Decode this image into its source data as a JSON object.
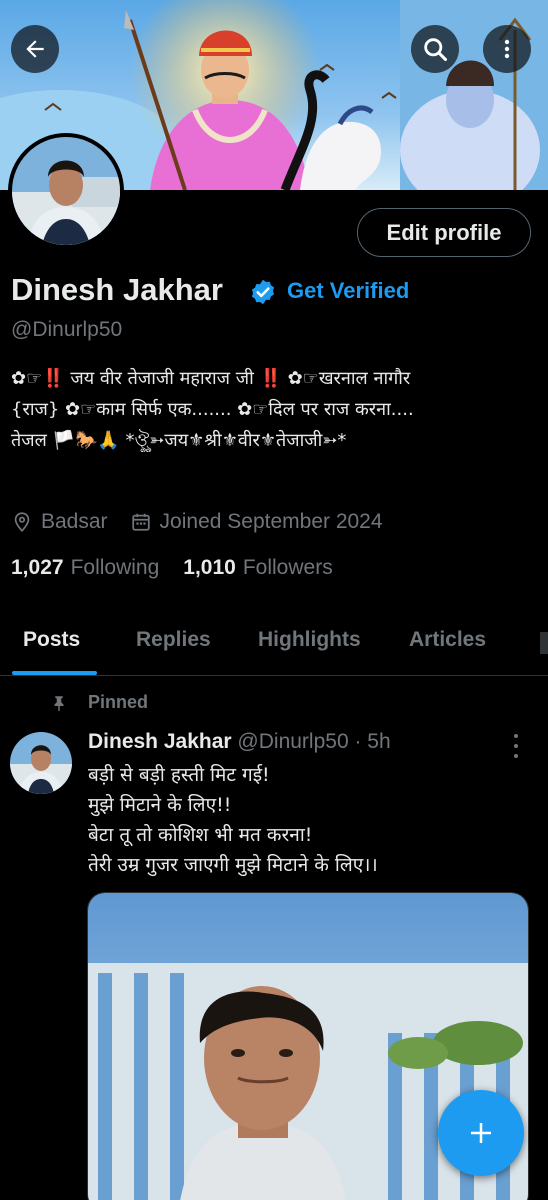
{
  "header": {
    "back_icon": "arrow-left-icon",
    "search_icon": "search-icon",
    "more_icon": "more-vertical-icon"
  },
  "profile": {
    "name": "Dinesh Jakhar",
    "get_verified_label": "Get Verified",
    "handle": "@Dinurlp50",
    "edit_profile_label": "Edit profile",
    "bio_lines": [
      "✿☞‼️ जय वीर तेजाजी महाराज जी ‼️ ✿☞खरनाल नागौर",
      "{राज} ✿☞काम सिर्फ एक....... ✿☞दिल पर राज करना....",
      "तेजल 🏳️🐎🙏 *ঔৣ➳जय⚜श्री⚜वीर⚜तेजाजी➳*"
    ],
    "location": "Badsar",
    "joined": "Joined September 2024",
    "following_count": "1,027",
    "following_label": "Following",
    "followers_count": "1,010",
    "followers_label": "Followers"
  },
  "tabs": [
    {
      "label": "Posts",
      "active": true
    },
    {
      "label": "Replies",
      "active": false
    },
    {
      "label": "Highlights",
      "active": false
    },
    {
      "label": "Articles",
      "active": false
    }
  ],
  "post": {
    "pinned_label": "Pinned",
    "author_name": "Dinesh Jakhar",
    "author_handle": "@Dinurlp50",
    "time": "· 5h",
    "lines": [
      "बड़ी से बड़ी हस्ती मिट गई!",
      "मुझे मिटाने के लिए!!",
      "बेटा तू तो कोशिश भी मत करना!",
      "तेरी उम्र गुजर जाएगी मुझे मिटाने के लिए।।"
    ]
  },
  "fab": {
    "icon": "plus-icon"
  },
  "colors": {
    "accent": "#1d9bf0",
    "background": "#000000",
    "text_primary": "#e7e9ea",
    "text_secondary": "#71767b",
    "border": "#2f3336"
  }
}
